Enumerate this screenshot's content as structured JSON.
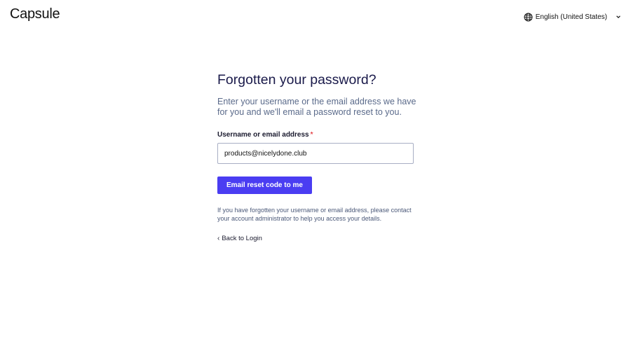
{
  "brand": {
    "logo_text": "Capsule"
  },
  "language": {
    "label": "English (United States)",
    "icon": "globe-icon",
    "dropdown_icon": "chevron-down-icon"
  },
  "form": {
    "title": "Forgotten your password?",
    "intro": "Enter your username or the email address we have for you and we'll email a password reset to you.",
    "field_label": "Username or email address",
    "required_marker": "*",
    "field_value": "products@nicelydone.club",
    "submit_label": "Email reset code to me",
    "help_text": "If you have forgotten your username or email address, please contact your account administrator to help you access your details.",
    "back_link_prefix": "‹",
    "back_link_label": "Back to Login"
  },
  "colors": {
    "accent": "#4a3df2",
    "required": "#e5484d",
    "title": "#1a1a4a",
    "muted_text": "#5a6a8a"
  }
}
